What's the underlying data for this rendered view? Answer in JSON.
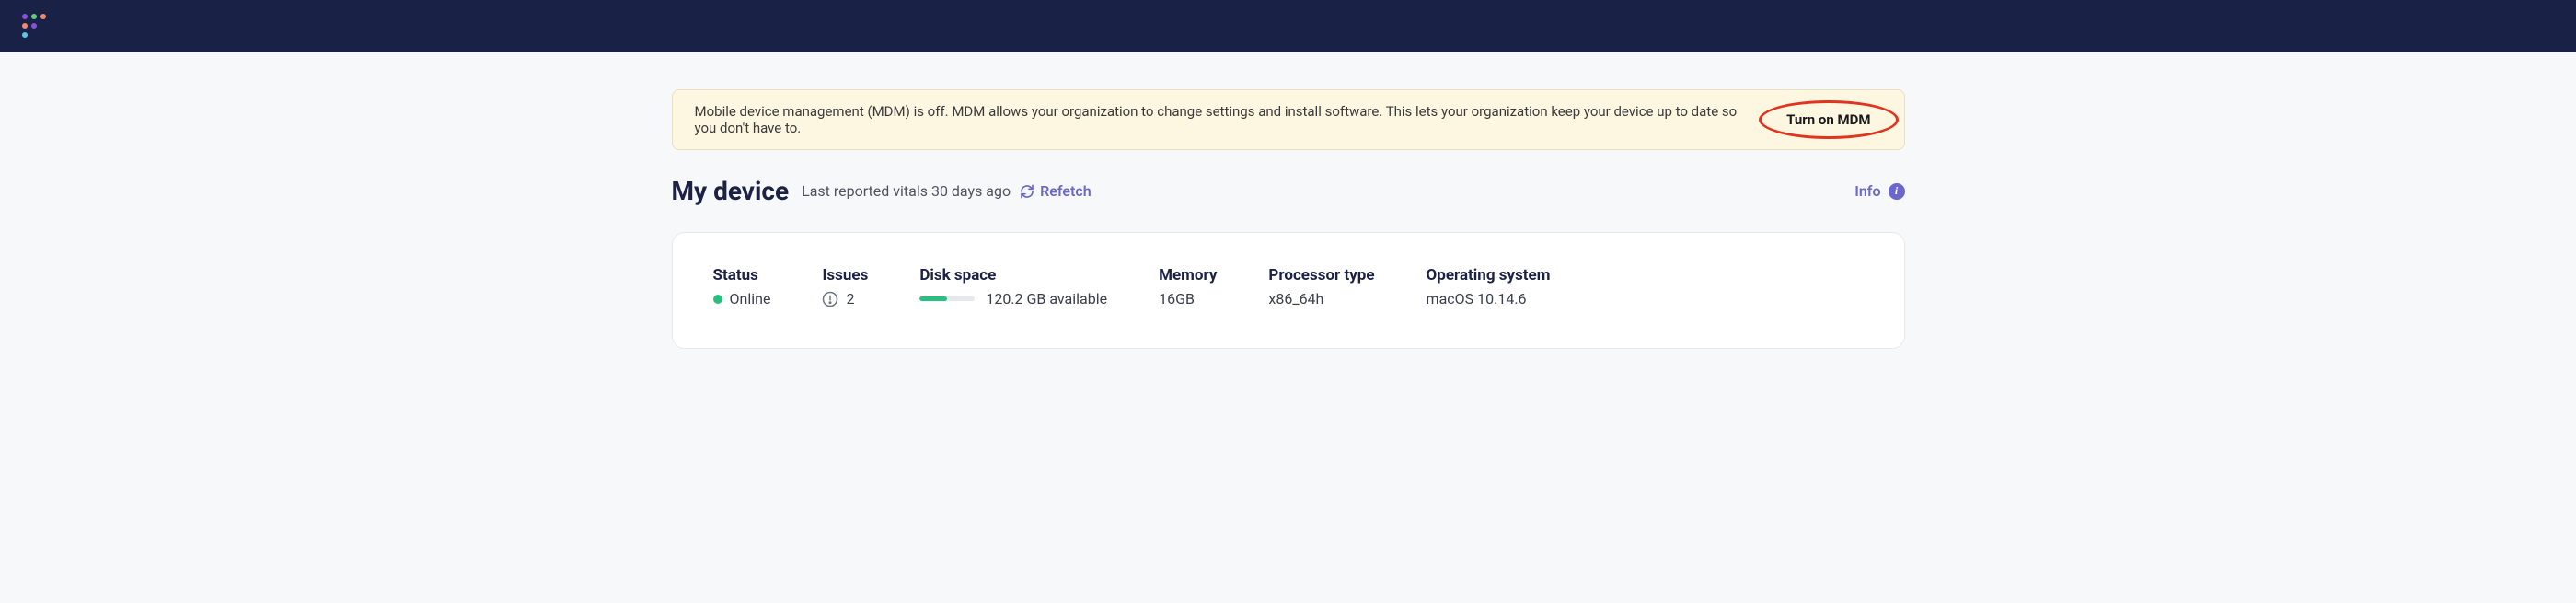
{
  "banner": {
    "text": "Mobile device management (MDM) is off. MDM allows your organization to change settings and install software. This lets your organization keep your device up to date so you don't have to.",
    "action_label": "Turn on MDM"
  },
  "page": {
    "title": "My device",
    "vitals_text": "Last reported vitals 30 days ago",
    "refetch_label": "Refetch",
    "info_label": "Info"
  },
  "device": {
    "status_label": "Status",
    "status_value": "Online",
    "issues_label": "Issues",
    "issues_value": "2",
    "disk_label": "Disk space",
    "disk_value": "120.2 GB available",
    "disk_fill_pct": "50%",
    "memory_label": "Memory",
    "memory_value": "16GB",
    "processor_label": "Processor type",
    "processor_value": "x86_64h",
    "os_label": "Operating system",
    "os_value": "macOS 10.14.6"
  },
  "colors": {
    "accent": "#6a67ce",
    "success": "#28c07e",
    "highlight": "#e2331f"
  }
}
